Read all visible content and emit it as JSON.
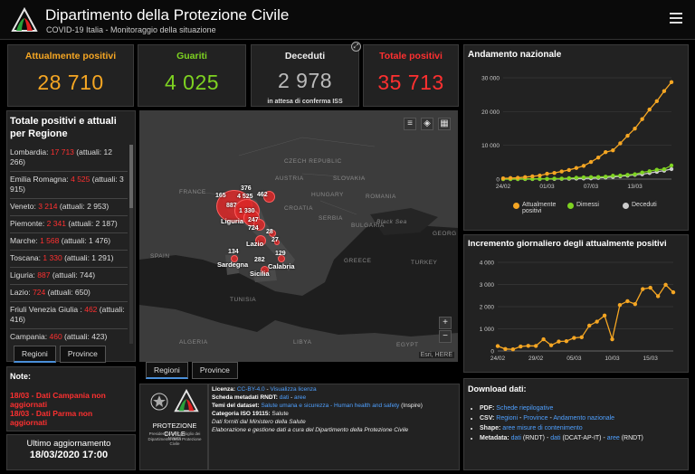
{
  "header": {
    "title": "Dipartimento della Protezione Civile",
    "subtitle": "COVID-19 Italia - Monitoraggio della situazione"
  },
  "colors": {
    "positivi": "#f5a623",
    "guariti": "#7ed321",
    "deceduti": "#bbbbbb",
    "totale": "#ff3030",
    "link": "#4fa0ff"
  },
  "stats": {
    "positivi": {
      "label": "Attualmente positivi",
      "value": "28 710"
    },
    "guariti": {
      "label": "Guariti",
      "value": "4 025"
    },
    "deceduti": {
      "label": "Deceduti",
      "value": "2 978",
      "note": "in attesa di conferma ISS"
    },
    "totale": {
      "label": "Totale positivi",
      "value": "35 713"
    }
  },
  "regions": {
    "title": "Totale positivi e attuali per Regione",
    "items": [
      {
        "name": "Lombardia:",
        "total": "17 713",
        "attuali": "(attuali: 12 266)"
      },
      {
        "name": "Emilia Romagna:",
        "total": "4 525",
        "attuali": "(attuali: 3 915)"
      },
      {
        "name": "Veneto:",
        "total": "3 214",
        "attuali": "(attuali: 2 953)"
      },
      {
        "name": "Piemonte:",
        "total": "2 341",
        "attuali": "(attuali: 2 187)"
      },
      {
        "name": "Marche:",
        "total": "1 568",
        "attuali": "(attuali: 1 476)"
      },
      {
        "name": "Toscana:",
        "total": "1 330",
        "attuali": "(attuali: 1 291)"
      },
      {
        "name": "Liguria:",
        "total": "887",
        "attuali": "(attuali: 744)"
      },
      {
        "name": "Lazio:",
        "total": "724",
        "attuali": "(attuali: 650)"
      },
      {
        "name": "Friuli Venezia Giulia :",
        "total": "462",
        "attuali": "(attuali: 416)"
      },
      {
        "name": "Campania:",
        "total": "460",
        "attuali": "(attuali: 423)"
      }
    ],
    "tabs": [
      "Regioni",
      "Province"
    ]
  },
  "note": {
    "label": "Note:",
    "lines": [
      "18/03 - Dati Campania non aggiornati",
      "18/03 - Dati Parma non aggiornati"
    ]
  },
  "update": {
    "label": "Ultimo aggiornamento",
    "value": "18/03/2020 17:00"
  },
  "map": {
    "countries": [
      "CZECH REPUBLIC",
      "SLOVAKIA",
      "AUSTRIA",
      "HUNGARY",
      "ROMANIA",
      "FRANCE",
      "CROATIA",
      "SERBIA",
      "BULGARIA",
      "SPAIN",
      "GREECE",
      "TURKEY",
      "TUNISIA",
      "ALGERIA",
      "LIBYA",
      "EGYPT",
      "GEORG",
      "Black Sea"
    ],
    "values": [
      "376",
      "462",
      "165",
      "4 525",
      "887",
      "1 330",
      "247",
      "724",
      "28",
      "27",
      "134",
      "129",
      "282"
    ],
    "region_labels": [
      "Liguria",
      "Lazio",
      "Sardegna",
      "Calabria",
      "Sicilia"
    ],
    "attribution": "Esri, HERE",
    "zoom_in": "+",
    "zoom_out": "−",
    "tabs": [
      "Regioni",
      "Province"
    ]
  },
  "logo": {
    "name": "PROTEZIONE CIVILE",
    "sub1": "Presidenza del Consiglio dei Ministri",
    "sub2": "Dipartimento della Protezione Civile"
  },
  "footer": {
    "licenza_label": "Licenza:",
    "licenza_val": "CC-BY-4.0",
    "licenza_link": "Visualizza licenza",
    "scheda_label": "Scheda metadati RNDT:",
    "scheda_dati": "dati",
    "scheda_aree": "aree",
    "temi_label": "Temi del dataset:",
    "temi_link": "Salute umana e sicurezza - Human health and safety",
    "temi_suffix": "(Inspire)",
    "iso_label": "Categoria ISO 19115:",
    "iso_val": "Salute",
    "line5": "Dati forniti dal Ministero della Salute",
    "line6": "Elaborazione e gestione dati a cura del Dipartimento della Protezione Civile"
  },
  "download": {
    "title": "Download dati:",
    "pdf_label": "PDF:",
    "pdf_link": "Schede riepilogative",
    "csv_label": "CSV:",
    "csv_regioni": "Regioni",
    "csv_province": "Province",
    "csv_andamento": "Andamento nazionale",
    "shape_label": "Shape:",
    "shape_link": "aree misure di contenimento",
    "meta_label": "Metadata:",
    "meta_dati": "dati",
    "meta_rndt": "(RNDT) -",
    "meta_dati2": "dati",
    "meta_dcat": "(DCAT-AP-IT) -",
    "meta_aree": "aree",
    "meta_rndt2": "(RNDT)"
  },
  "chart_data": [
    {
      "type": "line",
      "title": "Andamento nazionale",
      "x": [
        "24/02",
        "25/02",
        "26/02",
        "27/02",
        "28/02",
        "29/02",
        "01/03",
        "02/03",
        "03/03",
        "04/03",
        "05/03",
        "06/03",
        "07/03",
        "08/03",
        "09/03",
        "10/03",
        "11/03",
        "12/03",
        "13/03",
        "14/03",
        "15/03",
        "16/03",
        "17/03",
        "18/03"
      ],
      "xticks": [
        "24/02",
        "01/03",
        "07/03",
        "13/03"
      ],
      "yticks": [
        "0",
        "10 000",
        "20 000",
        "30 000"
      ],
      "ylim": [
        0,
        30000
      ],
      "series": [
        {
          "name": "Attualmente positivi",
          "color": "#f5a623",
          "values": [
            221,
            311,
            385,
            588,
            821,
            1049,
            1577,
            1835,
            2263,
            2706,
            3296,
            3916,
            5061,
            6387,
            7985,
            8514,
            10590,
            12839,
            14955,
            17750,
            20603,
            23073,
            26062,
            28710
          ]
        },
        {
          "name": "Dimessi",
          "color": "#7ed321",
          "values": [
            1,
            1,
            3,
            45,
            46,
            50,
            83,
            149,
            160,
            276,
            414,
            523,
            589,
            622,
            724,
            1004,
            1045,
            1258,
            1439,
            1966,
            2335,
            2749,
            2941,
            4025
          ]
        },
        {
          "name": "Deceduti",
          "color": "#cccccc",
          "values": [
            7,
            10,
            12,
            17,
            21,
            29,
            34,
            52,
            79,
            107,
            148,
            197,
            233,
            366,
            463,
            631,
            827,
            1016,
            1266,
            1441,
            1809,
            2158,
            2503,
            2978
          ]
        }
      ]
    },
    {
      "type": "line",
      "title": "Incremento giornaliero degli attualmente positivi",
      "x": [
        "24/02",
        "25/02",
        "26/02",
        "27/02",
        "28/02",
        "29/02",
        "01/03",
        "02/03",
        "03/03",
        "04/03",
        "05/03",
        "06/03",
        "07/03",
        "08/03",
        "09/03",
        "10/03",
        "11/03",
        "12/03",
        "13/03",
        "14/03",
        "15/03",
        "16/03",
        "17/03",
        "18/03"
      ],
      "xticks": [
        "24/02",
        "29/02",
        "05/03",
        "10/03",
        "15/03"
      ],
      "yticks": [
        "0",
        "1 000",
        "2 000",
        "3 000",
        "4 000"
      ],
      "ylim": [
        0,
        4000
      ],
      "series": [
        {
          "name": "Incremento",
          "color": "#f5a623",
          "values": [
            221,
            90,
            74,
            203,
            233,
            228,
            528,
            258,
            428,
            443,
            590,
            620,
            1145,
            1326,
            1598,
            529,
            2076,
            2249,
            2116,
            2795,
            2853,
            2470,
            2989,
            2648
          ]
        }
      ]
    }
  ]
}
